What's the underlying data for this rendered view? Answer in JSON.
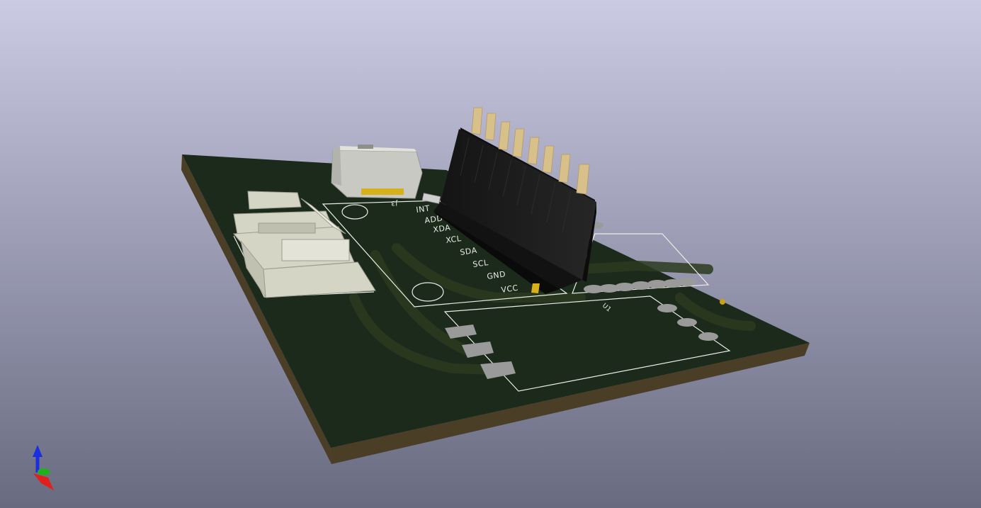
{
  "viewer": {
    "background_top": "#cbcbe4",
    "background_bottom": "#686a80"
  },
  "board": {
    "solder_mask_color": "#1c2a1b",
    "edge_color": "#4a3e26",
    "silkscreen_color": "#e9ece6",
    "copper_trace_color": "#2b3a1e",
    "pad_color": "#9a9a9a",
    "pin_color": "#d8c08a",
    "header_body_color": "#1c1c1c",
    "connector_color": "#d5d5c6"
  },
  "silkscreen": {
    "pin_labels": [
      "INT",
      "ADD",
      "XDA",
      "XCL",
      "SDA",
      "SCL",
      "GND",
      "VCC"
    ],
    "ref_j3": "J3",
    "ref_u1": "U1"
  },
  "axes": {
    "x_color": "#e0201c",
    "y_color": "#20b020",
    "z_color": "#1a30e0"
  }
}
